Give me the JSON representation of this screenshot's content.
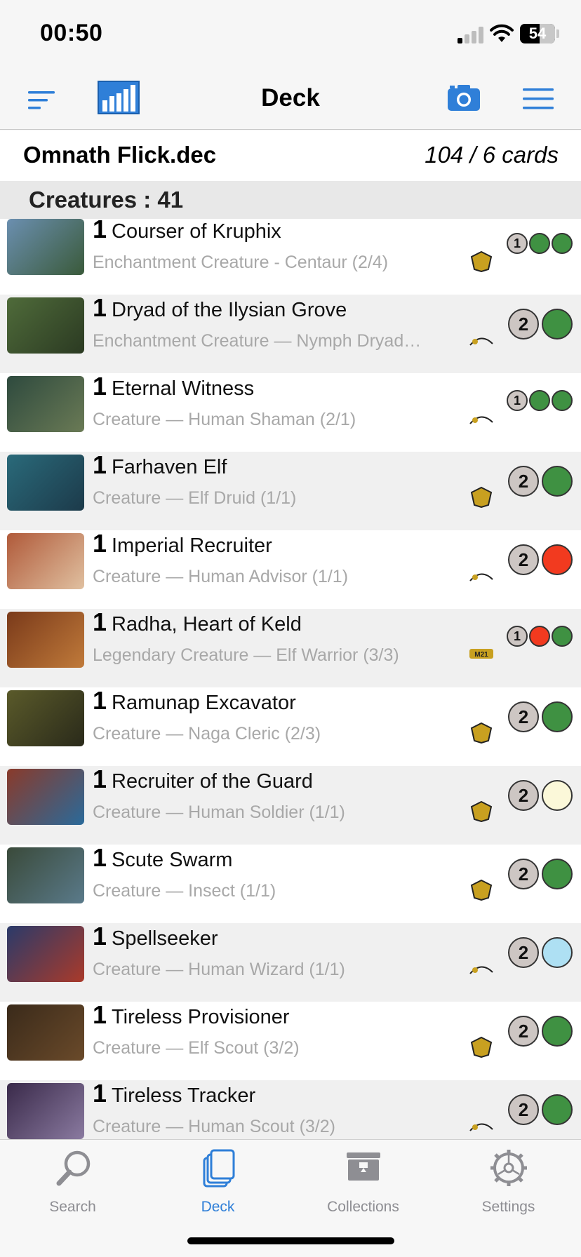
{
  "status": {
    "time": "00:50",
    "battery": "54"
  },
  "nav": {
    "title": "Deck"
  },
  "deck": {
    "name": "Omnath Flick.dec",
    "count": "104 / 6 cards"
  },
  "section": {
    "title": "Creatures : 41"
  },
  "colors": {
    "accent": "#2f7fd8",
    "green": "#3f9142",
    "red": "#f23a1f",
    "white": "#fbf8d9",
    "blue": "#aee0f3",
    "generic": "#cdc6c3"
  },
  "cards": [
    {
      "qty": "1",
      "name": "Courser of Kruphix",
      "type": "Enchantment Creature  - Centaur (2/4)",
      "set_icon": "theros-set-icon",
      "mana": {
        "generic": "1",
        "colors": [
          "green",
          "green"
        ],
        "size": "small"
      }
    },
    {
      "qty": "1",
      "name": "Dryad of the Ilysian Grove",
      "type": "Enchantment Creature — Nymph Dryad…",
      "set_icon": "comet-set-icon",
      "mana": {
        "generic": "2",
        "colors": [
          "green"
        ],
        "size": "big"
      }
    },
    {
      "qty": "1",
      "name": "Eternal Witness",
      "type": "Creature — Human Shaman (2/1)",
      "set_icon": "comet-set-icon",
      "mana": {
        "generic": "1",
        "colors": [
          "green",
          "green"
        ],
        "size": "small"
      }
    },
    {
      "qty": "1",
      "name": "Farhaven Elf",
      "type": "Creature — Elf Druid (1/1)",
      "set_icon": "shadowmoor-set-icon",
      "mana": {
        "generic": "2",
        "colors": [
          "green"
        ],
        "size": "big"
      }
    },
    {
      "qty": "1",
      "name": "Imperial Recruiter",
      "type": "Creature — Human Advisor (1/1)",
      "set_icon": "comet-set-icon",
      "mana": {
        "generic": "2",
        "colors": [
          "red"
        ],
        "size": "big"
      }
    },
    {
      "qty": "1",
      "name": "Radha, Heart of Keld",
      "type": "Legendary Creature — Elf Warrior (3/3)",
      "set_icon": "m21-set-icon",
      "mana": {
        "generic": "1",
        "colors": [
          "red",
          "green"
        ],
        "size": "small"
      }
    },
    {
      "qty": "1",
      "name": "Ramunap Excavator",
      "type": "Creature — Naga Cleric (2/3)",
      "set_icon": "hour-of-devastation-set-icon",
      "mana": {
        "generic": "2",
        "colors": [
          "green"
        ],
        "size": "big"
      }
    },
    {
      "qty": "1",
      "name": "Recruiter of the Guard",
      "type": "Creature — Human Soldier (1/1)",
      "set_icon": "conspiracy-set-icon",
      "mana": {
        "generic": "2",
        "colors": [
          "white"
        ],
        "size": "big"
      }
    },
    {
      "qty": "1",
      "name": "Scute Swarm",
      "type": "Creature — Insect (1/1)",
      "set_icon": "zendikar-rising-set-icon",
      "mana": {
        "generic": "2",
        "colors": [
          "green"
        ],
        "size": "big"
      }
    },
    {
      "qty": "1",
      "name": "Spellseeker",
      "type": "Creature — Human Wizard (1/1)",
      "set_icon": "comet-set-icon",
      "mana": {
        "generic": "2",
        "colors": [
          "blue"
        ],
        "size": "big"
      }
    },
    {
      "qty": "1",
      "name": "Tireless Provisioner",
      "type": "Creature — Elf Scout (3/2)",
      "set_icon": "lotr-set-icon",
      "mana": {
        "generic": "2",
        "colors": [
          "green"
        ],
        "size": "big"
      }
    },
    {
      "qty": "1",
      "name": "Tireless Tracker",
      "type": "Creature — Human Scout (3/2)",
      "set_icon": "comet-set-icon",
      "mana": {
        "generic": "2",
        "colors": [
          "green"
        ],
        "size": "big"
      }
    }
  ],
  "tabs": [
    {
      "label": "Search",
      "icon": "search-icon",
      "active": false
    },
    {
      "label": "Deck",
      "icon": "deck-icon",
      "active": true
    },
    {
      "label": "Collections",
      "icon": "collections-icon",
      "active": false
    },
    {
      "label": "Settings",
      "icon": "settings-icon",
      "active": false
    }
  ]
}
